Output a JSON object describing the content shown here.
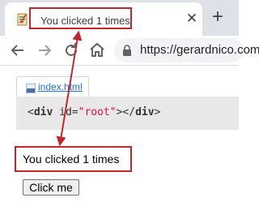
{
  "browser": {
    "tab": {
      "title": "You clicked 1 times",
      "close_glyph": "✕"
    },
    "new_tab_glyph": "+",
    "url": "https://gerardnico.com",
    "icons": {
      "back": "arrow-left-icon",
      "forward": "arrow-right-icon",
      "reload": "reload-icon",
      "home": "home-icon",
      "lock": "lock-icon",
      "favicon": "notebook-favicon-icon"
    }
  },
  "page": {
    "file_tab_label": "index.html",
    "code": {
      "open_tag": "div",
      "attr_name": "id",
      "attr_value": "\"root\"",
      "close_tag": "div"
    },
    "output_text": "You clicked 1 times",
    "button_label": "Click me"
  },
  "annotation": {
    "color": "#c1272d"
  }
}
